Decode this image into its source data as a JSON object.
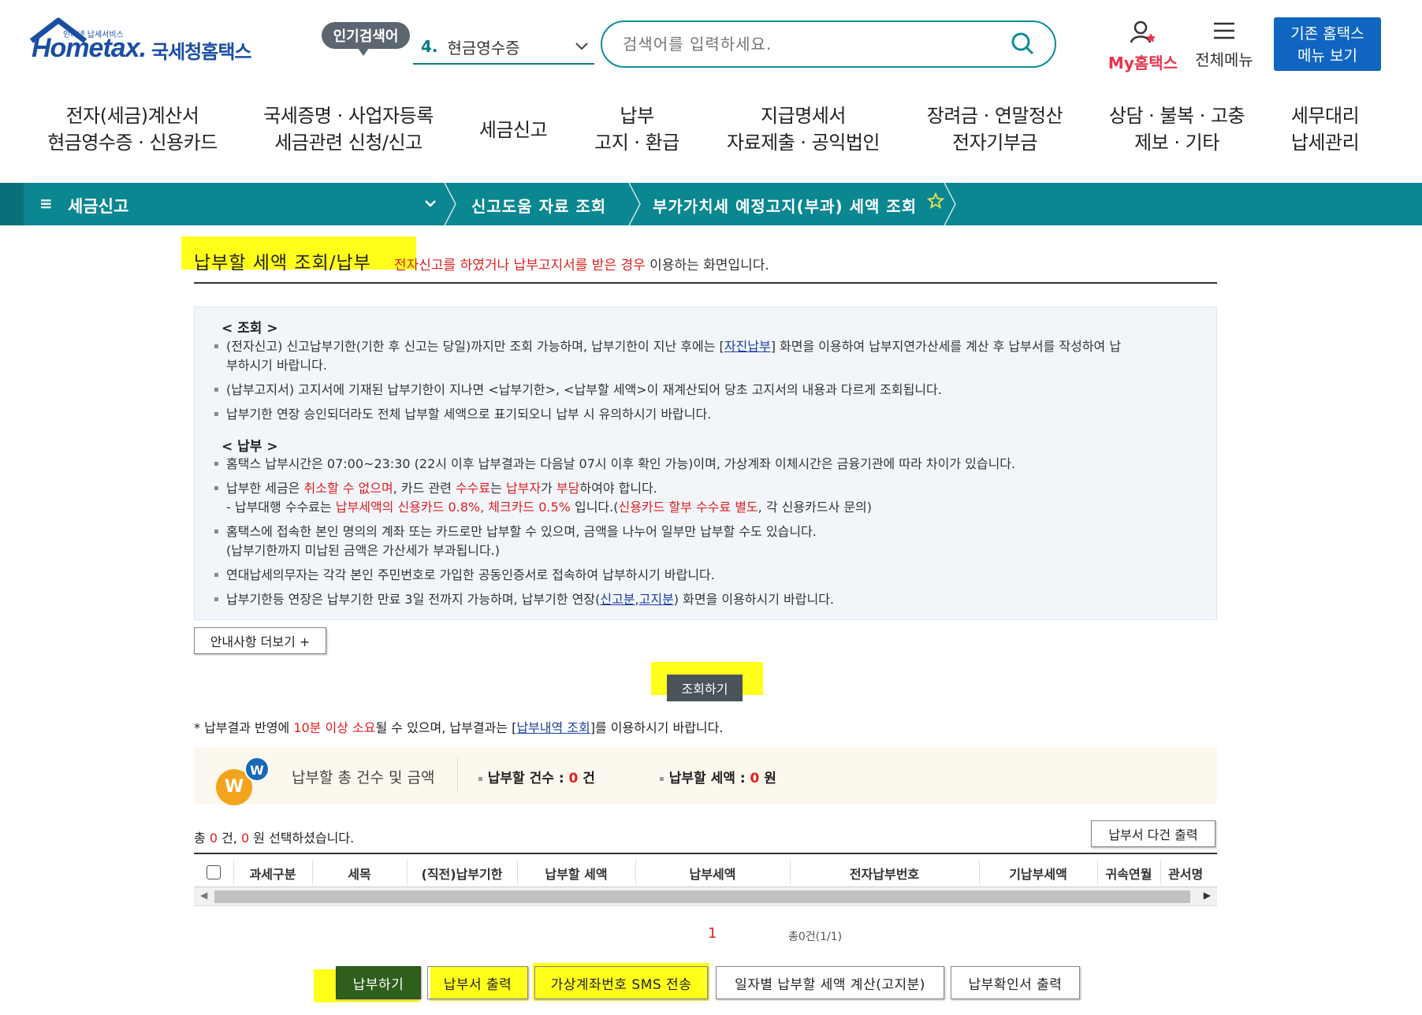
{
  "header": {
    "logo_tagline": "인터넷 납세서비스",
    "logo_name": "Hometax.",
    "logo_kr": "국세청홈택스",
    "popular_label": "인기검색어",
    "popular_num": "4.",
    "popular_keyword": "현금영수증",
    "search_placeholder": "검색어를 입력하세요.",
    "my_hometax": "My홈택스",
    "all_menu": "전체메뉴",
    "old_hometax_line1": "기존 홈택스",
    "old_hometax_line2": "메뉴 보기"
  },
  "gnav": [
    {
      "line1": "전자(세금)계산서",
      "line2": "현금영수증 · 신용카드"
    },
    {
      "line1": "국세증명 · 사업자등록",
      "line2": "세금관련 신청/신고"
    },
    {
      "line1": "세금신고",
      "line2": ""
    },
    {
      "line1": "납부",
      "line2": "고지 · 환급"
    },
    {
      "line1": "지급명세서",
      "line2": "자료제출 · 공익법인"
    },
    {
      "line1": "장려금 · 연말정산",
      "line2": "전자기부금"
    },
    {
      "line1": "상담 · 불복 · 고충",
      "line2": "제보 · 기타"
    },
    {
      "line1": "세무대리",
      "line2": "납세관리"
    }
  ],
  "breadcrumb": {
    "menu_icon": "≡",
    "title": "세금신고",
    "item1": "신고도움 자료 조회",
    "item2": "부가가치세 예정고지(부과) 세액 조회"
  },
  "page": {
    "title": "납부할 세액 조회/납부",
    "desc_red": "전자신고를 하였거나 납부고지서를 받은 경우",
    "desc_rest": " 이용하는 화면입니다."
  },
  "guide": {
    "h1": "< 조회 >",
    "q1a": "(전자신고) 신고납부기한(기한 후 신고는 당일)까지만 조회 가능하며, 납부기한이 지난 후에는 [",
    "q1link": "자진납부",
    "q1b": "] 화면을 이용하여 납부지연가산세를 계산 후 납부서를 작성하여 납",
    "q1c": "부하시기 바랍니다.",
    "q2": "(납부고지서) 고지서에 기재된 납부기한이 지나면 <납부기한>, <납부할 세액>이 재계산되어 당초 고지서의 내용과 다르게 조회됩니다.",
    "q3": "납부기한 연장 승인되더라도 전체 납부할 세액으로 표기되오니 납부 시 유의하시기 바랍니다.",
    "h2": "< 납부 >",
    "p1": "홈택스 납부시간은 07:00~23:30 (22시 이후 납부결과는 다음날 07시 이후 확인 가능)이며, 가상계좌 이체시간은 금융기관에 따라 차이가 있습니다.",
    "p2a": "납부한 세금은 ",
    "p2red1": "취소할 수 없으며",
    "p2b": ", 카드 관련 ",
    "p2red2": "수수료",
    "p2c": "는 ",
    "p2red3": "납부자",
    "p2d": "가 ",
    "p2red4": "부담",
    "p2e": "하여야 합니다.",
    "p2f": "- 납부대행 수수료는 ",
    "p2red5": "납부세액의 신용카드 0.8%, 체크카드 0.5%",
    "p2g": " 입니다.(",
    "p2red6": "신용카드 할부 수수료 별도",
    "p2h": ", 각 신용카드사 문의)",
    "p3a": "홈택스에 접속한 본인 명의의 계좌 또는 카드로만 납부할 수 있으며, 금액을 나누어 일부만 납부할 수도 있습니다.",
    "p3b": "(납부기한까지 미납된 금액은 가산세가 부과됩니다.)",
    "p4": "연대납세의무자는 각각 본인 주민번호로 가입한 공동인증서로 접속하여 납부하시기 바랍니다.",
    "p5a": "납부기한등 연장은 납부기한 만료 3일 전까지 가능하며, 납부기한 연장(",
    "p5link1": "신고분",
    "p5comma": ",",
    "p5link2": "고지분",
    "p5b": ") 화면을 이용하시기 바랍니다."
  },
  "more_info": "안내사항 더보기 +",
  "search_button": "조회하기",
  "note": {
    "a": "* 납부결과 반영에 ",
    "red": "10분 이상 소요",
    "b": "될 수 있으며, 납부결과는 [",
    "link": "납부내역 조회",
    "c": "]를 이용하시기 바랍니다."
  },
  "summary": {
    "w1": "W",
    "w2": "W",
    "label": "납부할 총 건수 및 금액",
    "count_label": "납부할 건수 : ",
    "count_value": "0",
    "count_unit": " 건",
    "amount_label": "납부할 세액 : ",
    "amount_value": "0",
    "amount_unit": " 원"
  },
  "selection": {
    "a": "총 ",
    "count": "0",
    "b": " 건, ",
    "amount": "0",
    "c": " 원 선택하셨습니다."
  },
  "multi_print": "납부서 다건 출력",
  "table_headers": [
    "과세구분",
    "세목",
    "(직전)납부기한",
    "납부할 세액",
    "납부세액",
    "전자납부번호",
    "기납부세액",
    "귀속연월",
    "관서명"
  ],
  "pagination": {
    "page": "1",
    "total": "총0건(1/1)"
  },
  "buttons": {
    "pay": "납부하기",
    "print": "납부서 출력",
    "sms": "가상계좌번호 SMS 전송",
    "daily": "일자별 납부할 세액 계산(고지분)",
    "confirm": "납부확인서 출력"
  },
  "colors": {
    "teal": "#0b8791",
    "red": "#e01e1e",
    "highlight": "#ffff1a",
    "navy": "#1065c0"
  }
}
